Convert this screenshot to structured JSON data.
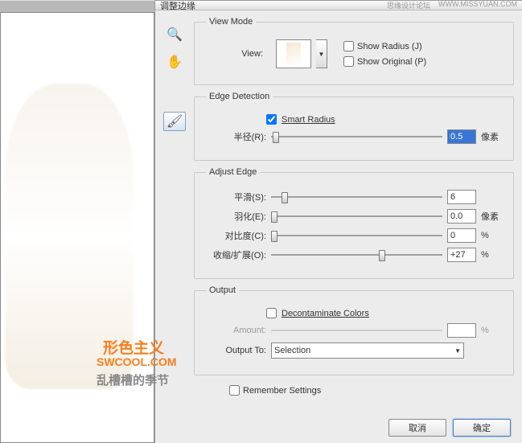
{
  "header": {
    "title": "调整边缘",
    "forum_text": "思缘设计论坛",
    "site_url": "WWW.MISSYUAN.COM"
  },
  "view_mode": {
    "legend": "View Mode",
    "view_label": "View:",
    "show_radius": "Show Radius (J)",
    "show_original": "Show Original (P)"
  },
  "edge_detection": {
    "legend": "Edge Detection",
    "smart_radius": "Smart Radius",
    "smart_radius_checked": true,
    "radius_label": "半径(R):",
    "radius_value": "0.5",
    "radius_unit": "像素"
  },
  "adjust_edge": {
    "legend": "Adjust Edge",
    "smooth_label": "平滑(S):",
    "smooth_value": "6",
    "feather_label": "羽化(E):",
    "feather_value": "0.0",
    "feather_unit": "像素",
    "contrast_label": "对比度(C):",
    "contrast_value": "0",
    "contrast_unit": "%",
    "shift_label": "收缩/扩展(O):",
    "shift_value": "+27",
    "shift_unit": "%"
  },
  "output": {
    "legend": "Output",
    "decontaminate": "Decontaminate Colors",
    "amount_label": "Amount:",
    "amount_unit": "%",
    "output_to_label": "Output To:",
    "output_to_value": "Selection"
  },
  "remember": "Remember Settings",
  "buttons": {
    "cancel": "取消",
    "ok": "确定"
  },
  "watermarks": {
    "brand_cn": "形色主义",
    "brand_en": "SWCOOL.COM",
    "tagline": "乱槽槽的季节"
  }
}
